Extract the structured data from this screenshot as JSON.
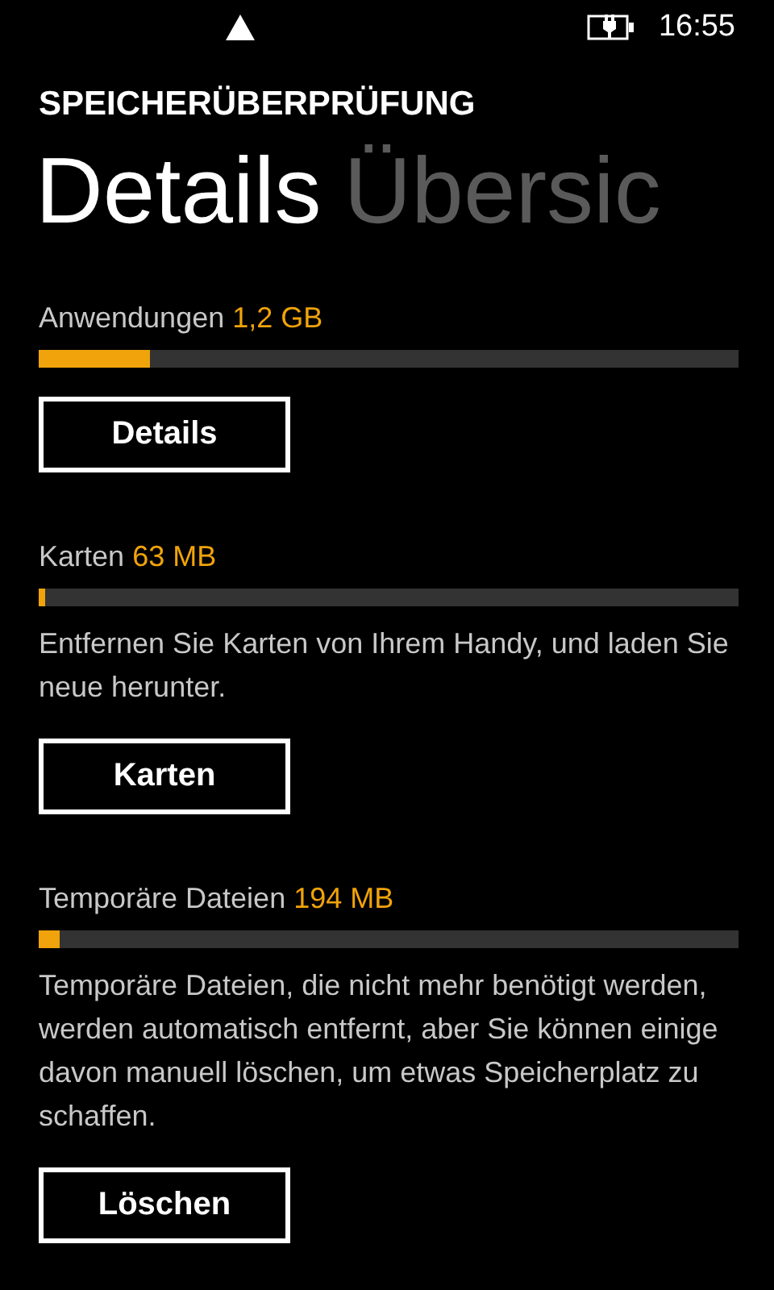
{
  "status_bar": {
    "time": "16:55"
  },
  "app_title": "SPEICHERÜBERPRÜFUNG",
  "pivot": [
    {
      "label": "Details",
      "selected": true
    },
    {
      "label": "Übersic",
      "selected": false
    }
  ],
  "sections": [
    {
      "label": "Anwendungen",
      "size": "1,2 GB",
      "level": 0.16,
      "button": "Details"
    },
    {
      "label": "Karten",
      "size": "63 MB",
      "level": 0.01,
      "description": "Entfernen Sie Karten von Ihrem Handy, und laden Sie neue herunter.",
      "button": "Karten"
    },
    {
      "label": "Temporäre Dateien",
      "size": "194 MB",
      "level": 0.03,
      "description": "Temporäre Dateien, die nicht mehr benötigt werden, werden automatisch entfernt, aber Sie können einige davon manuell löschen, um etwas Speicherplatz zu schaffen.",
      "button": "Löschen"
    }
  ]
}
